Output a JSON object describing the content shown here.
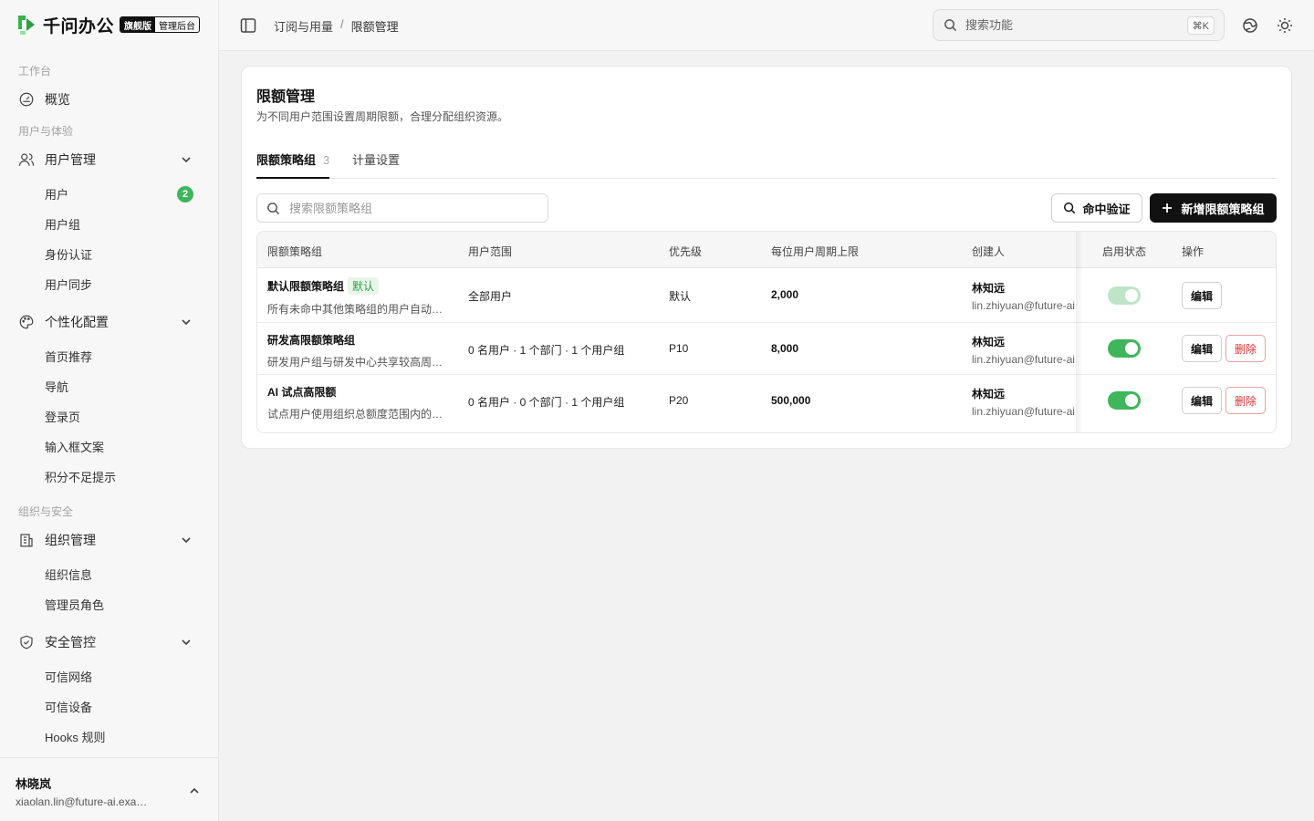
{
  "brand": {
    "name": "千问办公",
    "edition": "旗舰版",
    "console": "管理后台"
  },
  "sidebar": {
    "section_workspace": "工作台",
    "overview": "概览",
    "section_users": "用户与体验",
    "user_mgmt": "用户管理",
    "user_mgmt_items": [
      "用户",
      "用户组",
      "身份认证",
      "用户同步"
    ],
    "users_badge": "2",
    "personalization": "个性化配置",
    "personalization_items": [
      "首页推荐",
      "导航",
      "登录页",
      "输入框文案",
      "积分不足提示"
    ],
    "section_org": "组织与安全",
    "org_mgmt": "组织管理",
    "org_items": [
      "组织信息",
      "管理员角色"
    ],
    "security": "安全管控",
    "security_items": [
      "可信网络",
      "可信设备",
      "Hooks 规则"
    ]
  },
  "current_user": {
    "name": "林晓岚",
    "email": "xiaolan.lin@future-ai.example.com"
  },
  "header": {
    "breadcrumb_parent": "订阅与用量",
    "breadcrumb_sep": "/",
    "breadcrumb_current": "限额管理",
    "search_placeholder": "搜索功能",
    "shortcut": "⌘K"
  },
  "page": {
    "title": "限额管理",
    "description": "为不同用户范围设置周期限额，合理分配组织资源。",
    "tabs": [
      {
        "label": "限额策略组",
        "count": "3"
      },
      {
        "label": "计量设置"
      }
    ],
    "search_placeholder": "搜索限额策略组",
    "verify_button": "命中验证",
    "new_button": "新增限额策略组"
  },
  "table": {
    "columns": [
      "限额策略组",
      "用户范围",
      "优先级",
      "每位用户周期上限",
      "创建人",
      "启用状态",
      "操作"
    ],
    "default_tag": "默认",
    "edit_label": "编辑",
    "delete_label": "删除",
    "rows": [
      {
        "name": "默认限额策略组",
        "is_default": true,
        "description": "所有未命中其他策略组的用户自动使用此策略组",
        "scope": "全部用户",
        "priority": "默认",
        "limit": "2,000",
        "creator_name": "林知远",
        "creator_email": "lin.zhiyuan@future-ai.example.com",
        "enabled": true,
        "toggle_disabled": true
      },
      {
        "name": "研发高限额策略组",
        "is_default": false,
        "description": "研发用户组与研发中心共享较高周期限额",
        "scope": "0 名用户 · 1 个部门 · 1 个用户组",
        "priority": "P10",
        "limit": "8,000",
        "creator_name": "林知远",
        "creator_email": "lin.zhiyuan@future-ai.example.com",
        "enabled": true,
        "toggle_disabled": false
      },
      {
        "name": "AI 试点高限额",
        "is_default": false,
        "description": "试点用户使用组织总额度范围内的高限额",
        "scope": "0 名用户 · 0 个部门 · 1 个用户组",
        "priority": "P20",
        "limit": "500,000",
        "creator_name": "林知远",
        "creator_email": "lin.zhiyuan@future-ai.example.com",
        "enabled": true,
        "toggle_disabled": false
      }
    ]
  }
}
